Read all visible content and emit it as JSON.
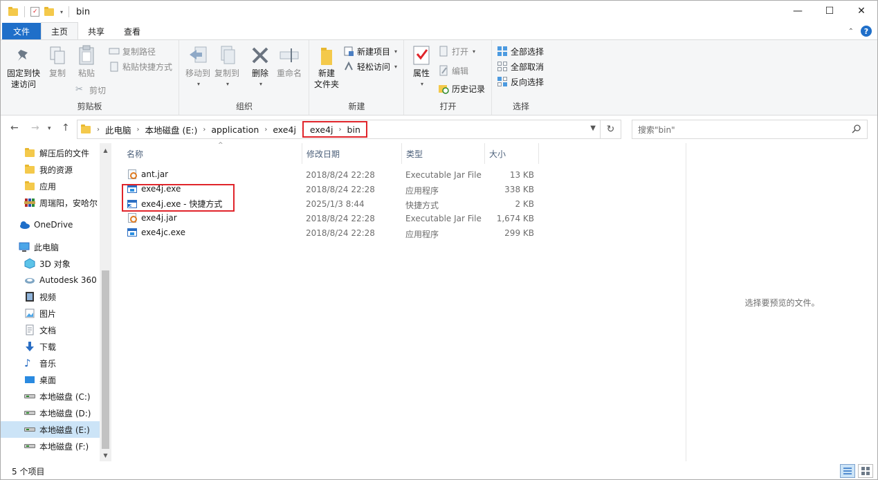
{
  "window": {
    "title": "bin",
    "controls": [
      "—",
      "☐",
      "✕"
    ]
  },
  "tabs": [
    {
      "label": "文件"
    },
    {
      "label": "主页"
    },
    {
      "label": "共享"
    },
    {
      "label": "查看"
    }
  ],
  "ribbon": {
    "clipboard": {
      "group_label": "剪贴板",
      "pin": "固定到快\n速访问",
      "copy": "复制",
      "paste": "粘贴",
      "copy_path": "复制路径",
      "paste_shortcut": "粘贴快捷方式",
      "cut": "剪切"
    },
    "organize": {
      "group_label": "组织",
      "move_to": "移动到",
      "copy_to": "复制到",
      "delete": "删除",
      "rename": "重命名"
    },
    "new": {
      "group_label": "新建",
      "new_folder": "新建\n文件夹",
      "new_item": "新建项目",
      "easy_access": "轻松访问"
    },
    "open": {
      "group_label": "打开",
      "properties": "属性",
      "open": "打开",
      "edit": "编辑",
      "history": "历史记录"
    },
    "select": {
      "group_label": "选择",
      "select_all": "全部选择",
      "select_none": "全部取消",
      "invert": "反向选择"
    }
  },
  "address": {
    "crumbs": [
      "此电脑",
      "本地磁盘 (E:)",
      "application",
      "exe4j",
      "exe4j",
      "bin"
    ]
  },
  "search": {
    "placeholder": "搜索\"bin\""
  },
  "sidebar": {
    "items": [
      {
        "label": "解压后的文件",
        "icon": "folder-icon"
      },
      {
        "label": "我的资源",
        "icon": "folder-icon"
      },
      {
        "label": "应用",
        "icon": "folder-icon"
      },
      {
        "label": "周瑞阳，安哈尔",
        "icon": "archive-icon"
      },
      {
        "label": "OneDrive",
        "icon": "cloud-icon"
      },
      {
        "label": "此电脑",
        "icon": "computer-icon"
      },
      {
        "label": "3D 对象",
        "icon": "cube-icon"
      },
      {
        "label": "Autodesk 360",
        "icon": "autodesk-icon"
      },
      {
        "label": "视频",
        "icon": "video-icon"
      },
      {
        "label": "图片",
        "icon": "picture-icon"
      },
      {
        "label": "文档",
        "icon": "document-icon"
      },
      {
        "label": "下载",
        "icon": "download-icon"
      },
      {
        "label": "音乐",
        "icon": "music-icon"
      },
      {
        "label": "桌面",
        "icon": "desktop-icon"
      },
      {
        "label": "本地磁盘 (C:)",
        "icon": "drive-icon"
      },
      {
        "label": "本地磁盘 (D:)",
        "icon": "drive-icon"
      },
      {
        "label": "本地磁盘 (E:)",
        "icon": "drive-icon",
        "selected": true
      },
      {
        "label": "本地磁盘 (F:)",
        "icon": "drive-icon"
      }
    ]
  },
  "columns": [
    "名称",
    "修改日期",
    "类型",
    "大小"
  ],
  "files": [
    {
      "name": "ant.jar",
      "date": "2018/8/24 22:28",
      "type": "Executable Jar File",
      "size": "13 KB",
      "icon": "jar-icon"
    },
    {
      "name": "exe4j.exe",
      "date": "2018/8/24 22:28",
      "type": "应用程序",
      "size": "338 KB",
      "icon": "exe-icon"
    },
    {
      "name": "exe4j.exe - 快捷方式",
      "date": "2025/1/3 8:44",
      "type": "快捷方式",
      "size": "2 KB",
      "icon": "shortcut-icon"
    },
    {
      "name": "exe4j.jar",
      "date": "2018/8/24 22:28",
      "type": "Executable Jar File",
      "size": "1,674 KB",
      "icon": "jar-icon"
    },
    {
      "name": "exe4jc.exe",
      "date": "2018/8/24 22:28",
      "type": "应用程序",
      "size": "299 KB",
      "icon": "exe-icon"
    }
  ],
  "preview": {
    "message": "选择要预览的文件。"
  },
  "status": {
    "count": "5 个项目"
  },
  "colors": {
    "accent": "#1f6fc9",
    "highlight_box": "#e0242a",
    "selection": "#cce4f7"
  }
}
